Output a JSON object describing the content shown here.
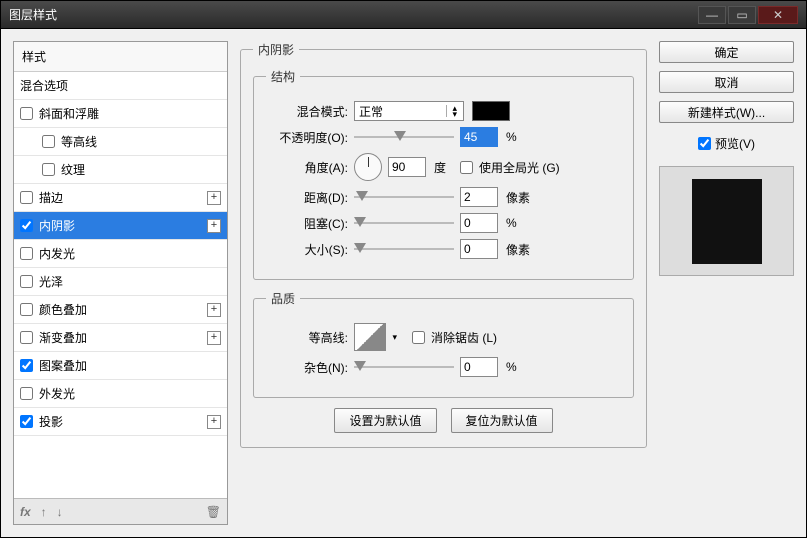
{
  "window": {
    "title": "图层样式"
  },
  "left": {
    "header": "样式",
    "blending": "混合选项",
    "items": [
      {
        "label": "斜面和浮雕",
        "checked": false,
        "plus": false,
        "sub": false
      },
      {
        "label": "等高线",
        "checked": false,
        "plus": false,
        "sub": true
      },
      {
        "label": "纹理",
        "checked": false,
        "plus": false,
        "sub": true
      },
      {
        "label": "描边",
        "checked": false,
        "plus": true,
        "sub": false
      },
      {
        "label": "内阴影",
        "checked": true,
        "plus": true,
        "sub": false,
        "selected": true
      },
      {
        "label": "内发光",
        "checked": false,
        "plus": false,
        "sub": false
      },
      {
        "label": "光泽",
        "checked": false,
        "plus": false,
        "sub": false
      },
      {
        "label": "颜色叠加",
        "checked": false,
        "plus": true,
        "sub": false
      },
      {
        "label": "渐变叠加",
        "checked": false,
        "plus": true,
        "sub": false
      },
      {
        "label": "图案叠加",
        "checked": true,
        "plus": false,
        "sub": false
      },
      {
        "label": "外发光",
        "checked": false,
        "plus": false,
        "sub": false
      },
      {
        "label": "投影",
        "checked": true,
        "plus": true,
        "sub": false
      }
    ],
    "footer": {
      "fx": "fx"
    }
  },
  "center": {
    "panel_title": "内阴影",
    "structure": {
      "legend": "结构",
      "blend_mode_label": "混合模式:",
      "blend_mode_value": "正常",
      "opacity_label": "不透明度(O):",
      "opacity_value": "45",
      "opacity_unit": "%",
      "angle_label": "角度(A):",
      "angle_value": "90",
      "angle_unit": "度",
      "global_light_label": "使用全局光 (G)",
      "distance_label": "距离(D):",
      "distance_value": "2",
      "distance_unit": "像素",
      "choke_label": "阻塞(C):",
      "choke_value": "0",
      "choke_unit": "%",
      "size_label": "大小(S):",
      "size_value": "0",
      "size_unit": "像素"
    },
    "quality": {
      "legend": "品质",
      "contour_label": "等高线:",
      "antialias_label": "消除锯齿 (L)",
      "noise_label": "杂色(N):",
      "noise_value": "0",
      "noise_unit": "%"
    },
    "defaults": {
      "set": "设置为默认值",
      "reset": "复位为默认值"
    }
  },
  "right": {
    "ok": "确定",
    "cancel": "取消",
    "new_style": "新建样式(W)...",
    "preview_label": "预览(V)"
  }
}
